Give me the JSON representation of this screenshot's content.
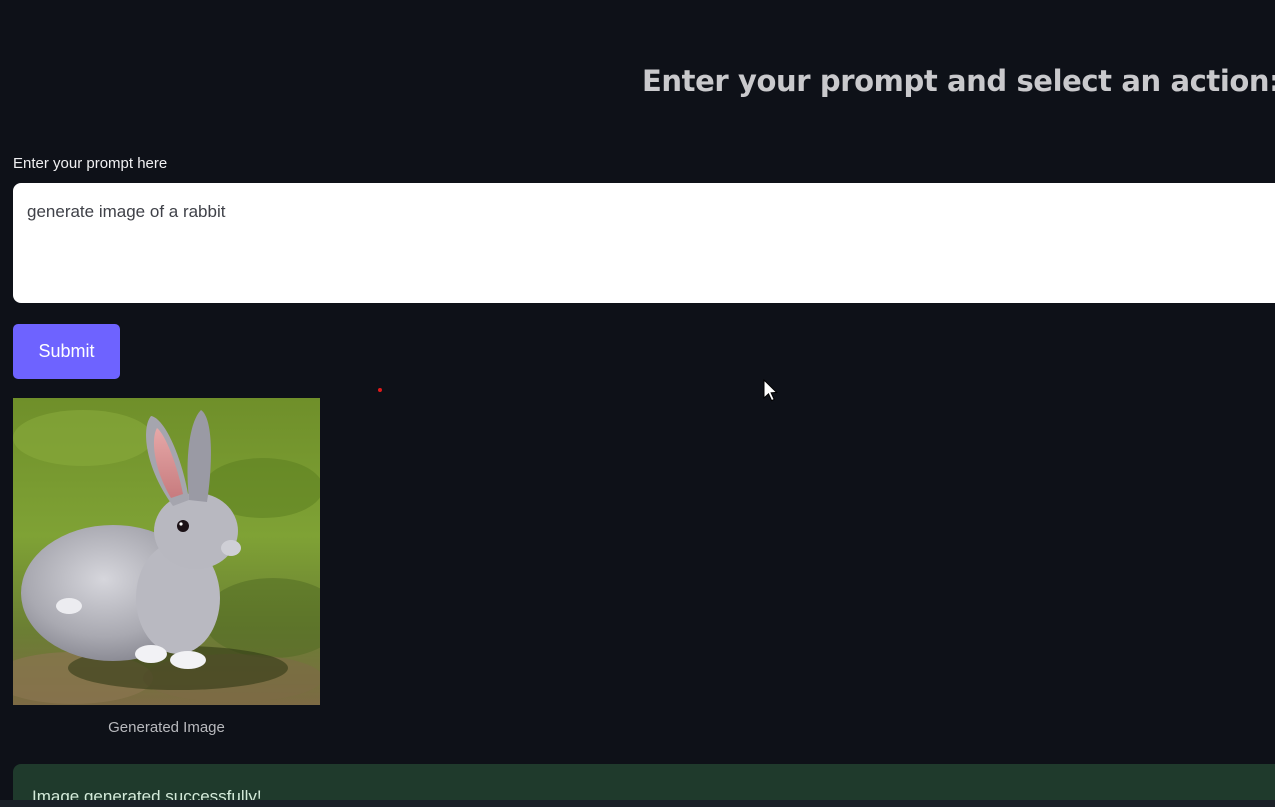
{
  "header": {
    "title": "Enter your prompt and select an action:"
  },
  "prompt": {
    "label": "Enter your prompt here",
    "value": "generate image of a rabbit"
  },
  "actions": {
    "submit_label": "Submit"
  },
  "result": {
    "caption": "Generated Image",
    "image_subject": "rabbit-on-grass"
  },
  "status": {
    "message": "Image generated successfully!"
  },
  "colors": {
    "background": "#0e1118",
    "accent": "#6e63ff",
    "success_bg": "#1f3a2c"
  }
}
